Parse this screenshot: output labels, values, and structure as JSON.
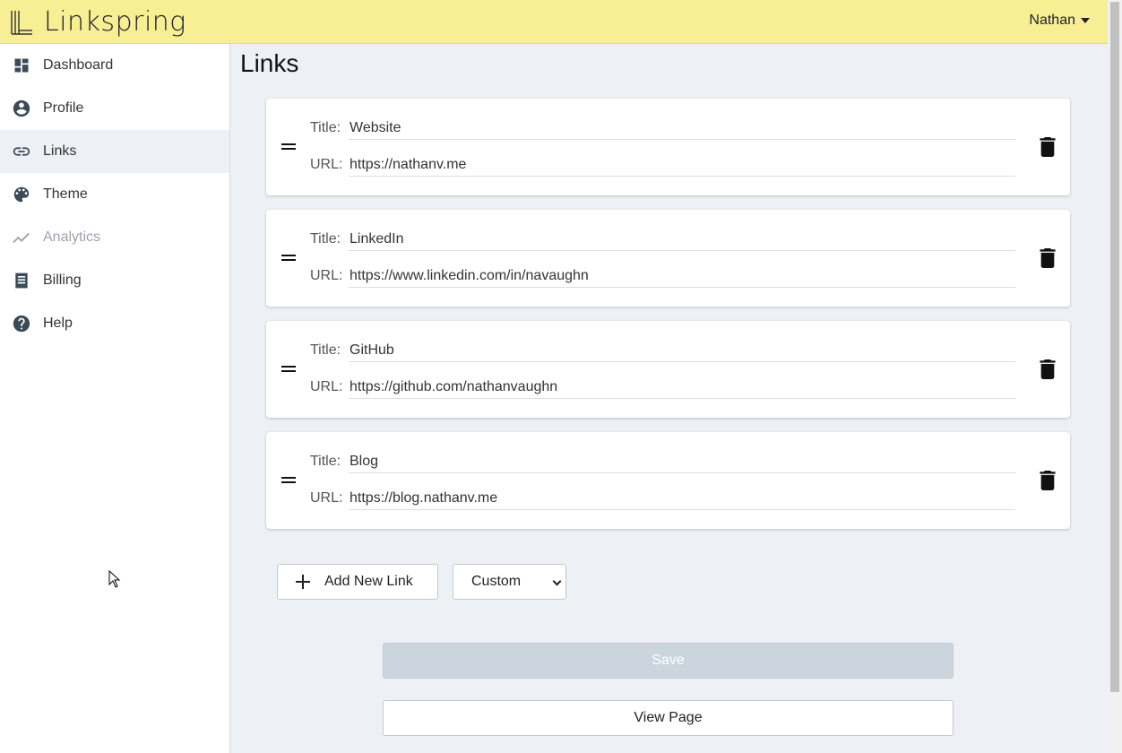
{
  "app": {
    "name": "Linkspring"
  },
  "header": {
    "user_name": "Nathan"
  },
  "sidebar": {
    "items": [
      {
        "label": "Dashboard",
        "icon": "dashboard-icon"
      },
      {
        "label": "Profile",
        "icon": "account-circle-icon"
      },
      {
        "label": "Links",
        "icon": "link-icon",
        "active": true
      },
      {
        "label": "Theme",
        "icon": "palette-icon"
      },
      {
        "label": "Analytics",
        "icon": "trending-up-icon",
        "disabled": true
      },
      {
        "label": "Billing",
        "icon": "receipt-icon"
      },
      {
        "label": "Help",
        "icon": "help-circle-icon"
      }
    ]
  },
  "main": {
    "title": "Links",
    "field_labels": {
      "title": "Title:",
      "url": "URL:"
    },
    "links": [
      {
        "title": "Website",
        "url": "https://nathanv.me"
      },
      {
        "title": "LinkedIn",
        "url": "https://www.linkedin.com/in/navaughn"
      },
      {
        "title": "GitHub",
        "url": "https://github.com/nathanvaughn"
      },
      {
        "title": "Blog",
        "url": "https://blog.nathanv.me"
      }
    ],
    "add_button_label": "Add New Link",
    "link_type_select": {
      "selected": "Custom"
    },
    "save_label": "Save",
    "view_page_label": "View Page"
  },
  "colors": {
    "header_bg": "#f8ef95",
    "page_bg": "#edf1f5",
    "save_disabled_bg": "#ccd5de",
    "sidebar_active_bg": "#edf1f5"
  }
}
